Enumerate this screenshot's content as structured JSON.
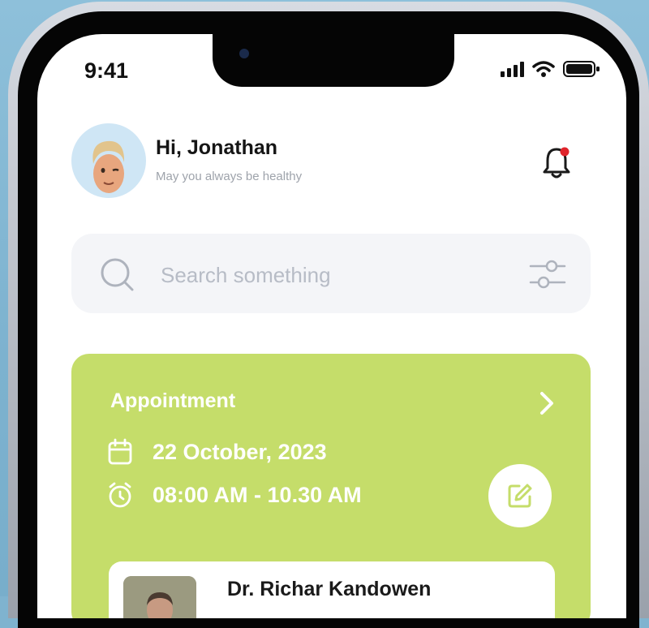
{
  "status_bar": {
    "time": "9:41"
  },
  "header": {
    "greeting": "Hi, Jonathan",
    "subtitle": "May you always be healthy"
  },
  "search": {
    "placeholder": "Search something"
  },
  "appointment": {
    "title": "Appointment",
    "date": "22 October, 2023",
    "time_range": "08:00 AM - 10.30 AM",
    "doctor_name": "Dr. Richar Kandowen"
  },
  "colors": {
    "card_accent": "#c5dd6a",
    "notification_dot": "#e0242b",
    "background": "#7fb3cf"
  }
}
